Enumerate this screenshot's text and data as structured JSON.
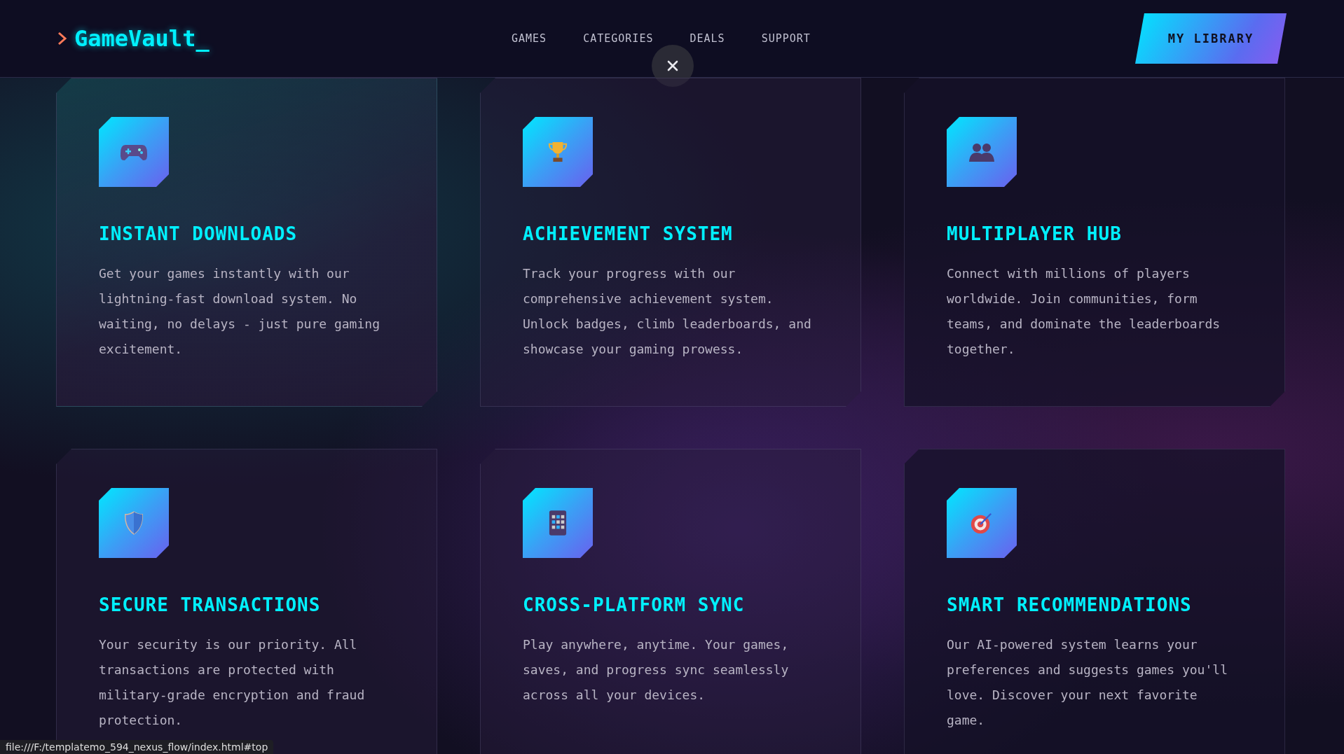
{
  "header": {
    "logo": "GameVault_",
    "nav": [
      {
        "label": "GAMES"
      },
      {
        "label": "CATEGORIES"
      },
      {
        "label": "DEALS"
      },
      {
        "label": "SUPPORT"
      }
    ],
    "library_button": "MY LIBRARY"
  },
  "cards": [
    {
      "kind": "gamepad",
      "title": "INSTANT DOWNLOADS",
      "text": "Get your games instantly with our lightning-fast download system. No waiting, no delays - just pure gaming excitement."
    },
    {
      "kind": "trophy",
      "title": "ACHIEVEMENT SYSTEM",
      "text": "Track your progress with our comprehensive achievement system. Unlock badges, climb leaderboards, and showcase your gaming prowess."
    },
    {
      "kind": "people",
      "title": "MULTIPLAYER HUB",
      "text": "Connect with millions of players worldwide. Join communities, form teams, and dominate the leaderboards together."
    },
    {
      "kind": "shield",
      "title": "SECURE TRANSACTIONS",
      "text": "Your security is our priority. All transactions are protected with military-grade encryption and fraud protection."
    },
    {
      "kind": "phone",
      "title": "CROSS-PLATFORM SYNC",
      "text": "Play anywhere, anytime. Your games, saves, and progress sync seamlessly across all your devices."
    },
    {
      "kind": "target",
      "title": "SMART RECOMMENDATIONS",
      "text": "Our AI-powered system learns your preferences and suggests games you'll love. Discover your next favorite game."
    }
  ],
  "status_bar": {
    "url": "file:///F:/templatemo_594_nexus_flow/index.html#top"
  }
}
